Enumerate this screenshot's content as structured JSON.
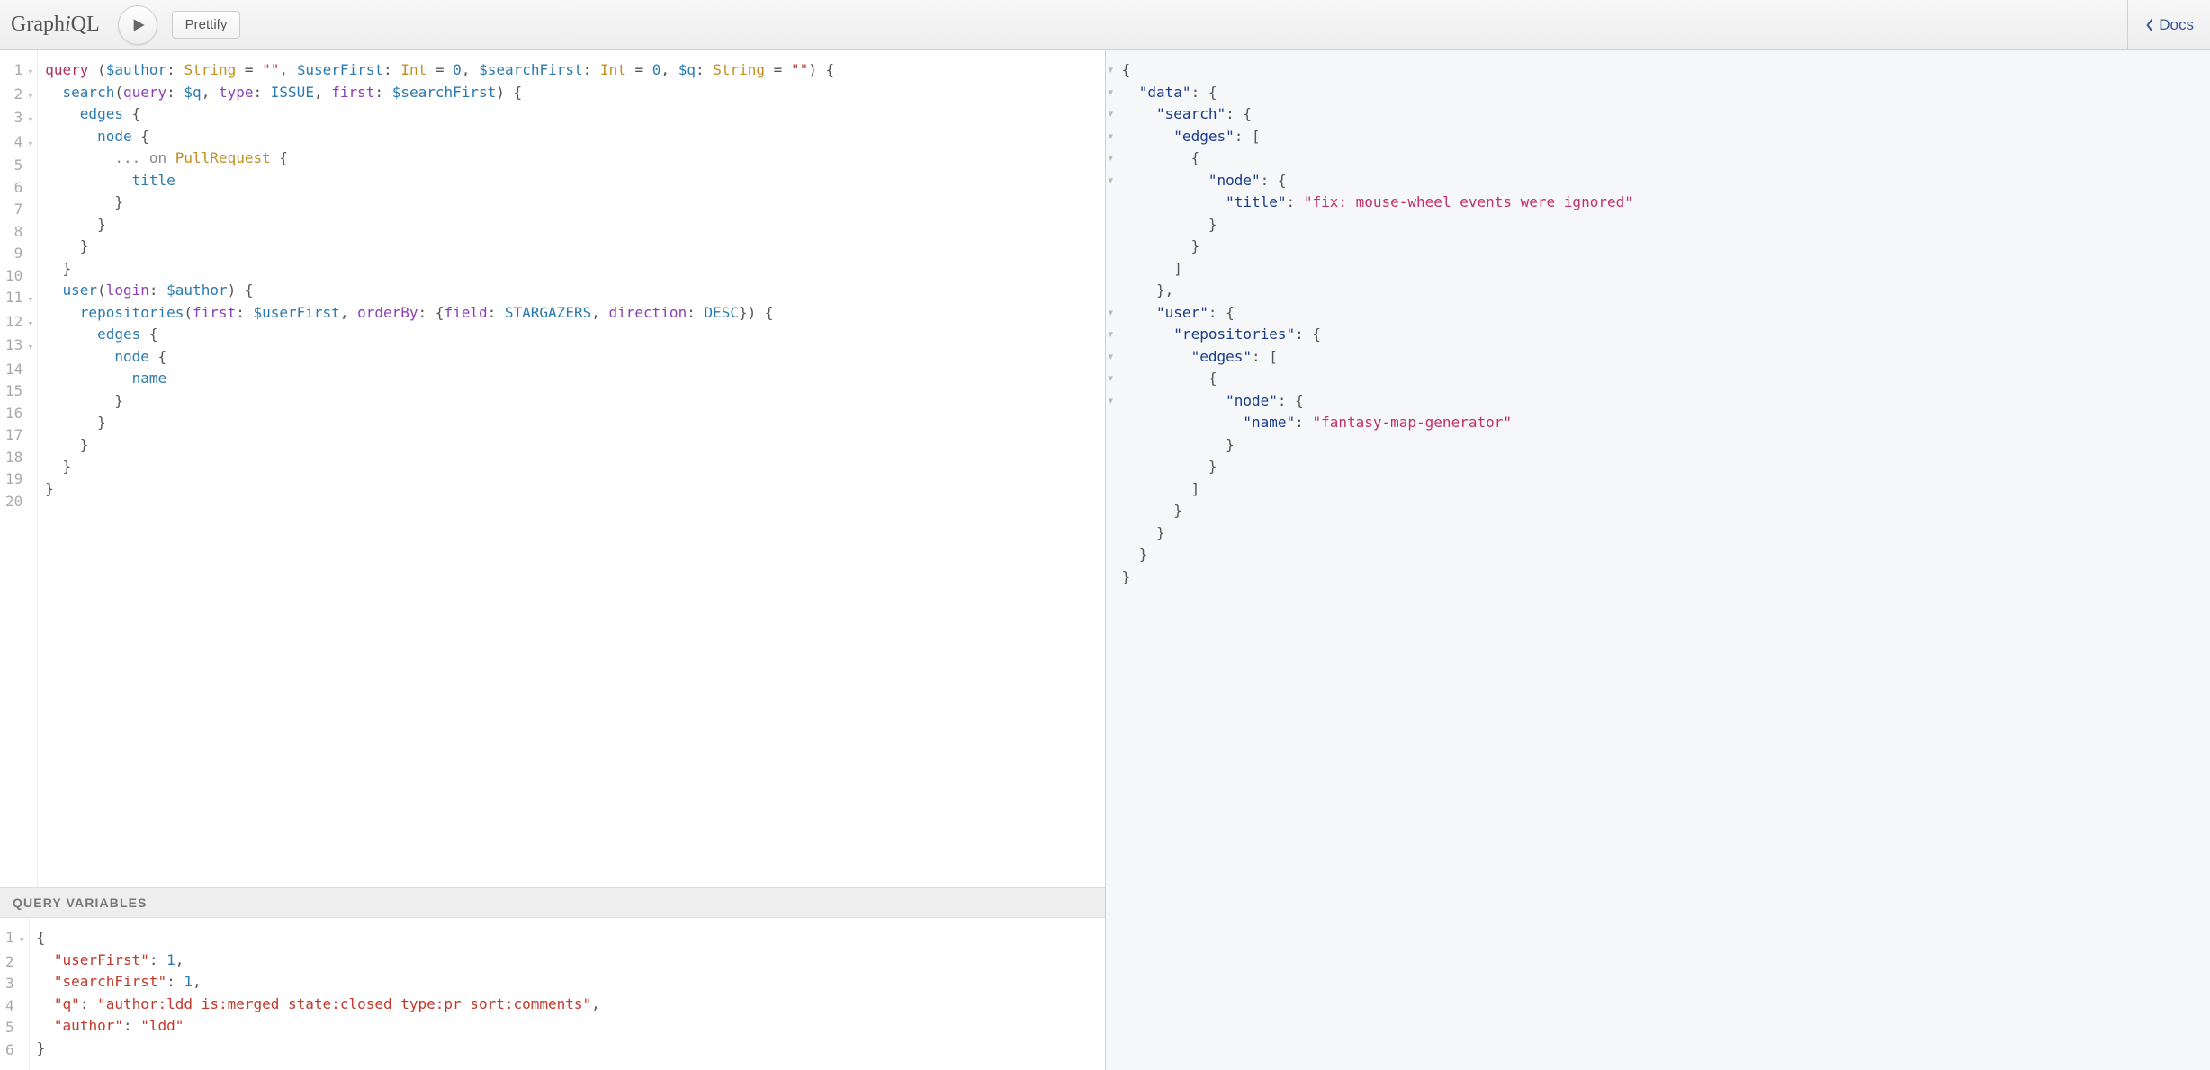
{
  "topbar": {
    "logo_pre": "Graph",
    "logo_i": "i",
    "logo_post": "QL",
    "prettify_label": "Prettify",
    "docs_label": "Docs"
  },
  "query_lines": [
    {
      "n": 1,
      "fold": true,
      "html": "<span class='kw'>query</span> <span class='pn'>(</span><span class='var'>$author</span><span class='pn'>:</span> <span class='type'>String</span> <span class='pn'>=</span> <span class='str'>\"\"</span><span class='pn'>,</span> <span class='var'>$userFirst</span><span class='pn'>:</span> <span class='type'>Int</span> <span class='pn'>=</span> <span class='num'>0</span><span class='pn'>,</span> <span class='var'>$searchFirst</span><span class='pn'>:</span> <span class='type'>Int</span> <span class='pn'>=</span> <span class='num'>0</span><span class='pn'>,</span> <span class='var'>$q</span><span class='pn'>:</span> <span class='type'>String</span> <span class='pn'>=</span> <span class='str'>\"\"</span><span class='pn'>) {</span>"
    },
    {
      "n": 2,
      "fold": true,
      "html": "  <span class='field'>search</span><span class='pn'>(</span><span class='arg'>query</span><span class='pn'>:</span> <span class='var'>$q</span><span class='pn'>,</span> <span class='arg'>type</span><span class='pn'>:</span> <span class='enum'>ISSUE</span><span class='pn'>,</span> <span class='arg'>first</span><span class='pn'>:</span> <span class='var'>$searchFirst</span><span class='pn'>) {</span>"
    },
    {
      "n": 3,
      "fold": true,
      "html": "    <span class='field'>edges</span> <span class='pn'>{</span>"
    },
    {
      "n": 4,
      "fold": true,
      "html": "      <span class='field'>node</span> <span class='pn'>{</span>"
    },
    {
      "n": 5,
      "fold": false,
      "html": "        <span class='on'>... on</span> <span class='type'>PullRequest</span> <span class='pn'>{</span>"
    },
    {
      "n": 6,
      "fold": false,
      "html": "          <span class='field'>title</span>"
    },
    {
      "n": 7,
      "fold": false,
      "html": "        <span class='pn'>}</span>"
    },
    {
      "n": 8,
      "fold": false,
      "html": "      <span class='pn'>}</span>"
    },
    {
      "n": 9,
      "fold": false,
      "html": "    <span class='pn'>}</span>"
    },
    {
      "n": 10,
      "fold": false,
      "html": "  <span class='pn'>}</span>"
    },
    {
      "n": 11,
      "fold": true,
      "html": "  <span class='field'>user</span><span class='pn'>(</span><span class='arg'>login</span><span class='pn'>:</span> <span class='var'>$author</span><span class='pn'>) {</span>"
    },
    {
      "n": 12,
      "fold": true,
      "html": "    <span class='field'>repositories</span><span class='pn'>(</span><span class='arg'>first</span><span class='pn'>:</span> <span class='var'>$userFirst</span><span class='pn'>,</span> <span class='arg'>orderBy</span><span class='pn'>: {</span><span class='arg'>field</span><span class='pn'>:</span> <span class='enum'>STARGAZERS</span><span class='pn'>,</span> <span class='arg'>direction</span><span class='pn'>:</span> <span class='enum'>DESC</span><span class='pn'>}) {</span>"
    },
    {
      "n": 13,
      "fold": true,
      "html": "      <span class='field'>edges</span> <span class='pn'>{</span>"
    },
    {
      "n": 14,
      "fold": false,
      "html": "        <span class='field'>node</span> <span class='pn'>{</span>"
    },
    {
      "n": 15,
      "fold": false,
      "html": "          <span class='field'>name</span>"
    },
    {
      "n": 16,
      "fold": false,
      "html": "        <span class='pn'>}</span>"
    },
    {
      "n": 17,
      "fold": false,
      "html": "      <span class='pn'>}</span>"
    },
    {
      "n": 18,
      "fold": false,
      "html": "    <span class='pn'>}</span>"
    },
    {
      "n": 19,
      "fold": false,
      "html": "  <span class='pn'>}</span>"
    },
    {
      "n": 20,
      "fold": false,
      "html": "<span class='pn'>}</span>"
    }
  ],
  "vars_header": "QUERY VARIABLES",
  "vars_lines": [
    {
      "n": 1,
      "fold": true,
      "html": "<span class='pn'>{</span>"
    },
    {
      "n": 2,
      "fold": false,
      "html": "  <span class='str'>\"userFirst\"</span><span class='pn'>:</span> <span class='num'>1</span><span class='pn'>,</span>"
    },
    {
      "n": 3,
      "fold": false,
      "html": "  <span class='str'>\"searchFirst\"</span><span class='pn'>:</span> <span class='num'>1</span><span class='pn'>,</span>"
    },
    {
      "n": 4,
      "fold": false,
      "html": "  <span class='str'>\"q\"</span><span class='pn'>:</span> <span class='str'>\"author:ldd is:merged state:closed type:pr sort:comments\"</span><span class='pn'>,</span>"
    },
    {
      "n": 5,
      "fold": false,
      "html": "  <span class='str'>\"author\"</span><span class='pn'>:</span> <span class='str'>\"ldd\"</span>"
    },
    {
      "n": 6,
      "fold": false,
      "html": "<span class='pn'>}</span>"
    }
  ],
  "response_lines": [
    {
      "fold": true,
      "html": "<span class='rp'>{</span>"
    },
    {
      "fold": true,
      "html": "  <span class='rkey'>\"data\"</span><span class='rp'>: {</span>"
    },
    {
      "fold": true,
      "html": "    <span class='rkey'>\"search\"</span><span class='rp'>: {</span>"
    },
    {
      "fold": true,
      "html": "      <span class='rkey'>\"edges\"</span><span class='rp'>: [</span>"
    },
    {
      "fold": true,
      "html": "        <span class='rp'>{</span>"
    },
    {
      "fold": true,
      "html": "          <span class='rkey'>\"node\"</span><span class='rp'>: {</span>"
    },
    {
      "fold": false,
      "html": "            <span class='rkey'>\"title\"</span><span class='rp'>:</span> <span class='rstr'>\"fix: mouse-wheel events were ignored\"</span>"
    },
    {
      "fold": false,
      "html": "          <span class='rp'>}</span>"
    },
    {
      "fold": false,
      "html": "        <span class='rp'>}</span>"
    },
    {
      "fold": false,
      "html": "      <span class='rp'>]</span>"
    },
    {
      "fold": false,
      "html": "    <span class='rp'>},</span>"
    },
    {
      "fold": true,
      "html": "    <span class='rkey'>\"user\"</span><span class='rp'>: {</span>"
    },
    {
      "fold": true,
      "html": "      <span class='rkey'>\"repositories\"</span><span class='rp'>: {</span>"
    },
    {
      "fold": true,
      "html": "        <span class='rkey'>\"edges\"</span><span class='rp'>: [</span>"
    },
    {
      "fold": true,
      "html": "          <span class='rp'>{</span>"
    },
    {
      "fold": true,
      "html": "            <span class='rkey'>\"node\"</span><span class='rp'>: {</span>"
    },
    {
      "fold": false,
      "html": "              <span class='rkey'>\"name\"</span><span class='rp'>:</span> <span class='rstr'>\"fantasy-map-generator\"</span>"
    },
    {
      "fold": false,
      "html": "            <span class='rp'>}</span>"
    },
    {
      "fold": false,
      "html": "          <span class='rp'>}</span>"
    },
    {
      "fold": false,
      "html": "        <span class='rp'>]</span>"
    },
    {
      "fold": false,
      "html": "      <span class='rp'>}</span>"
    },
    {
      "fold": false,
      "html": "    <span class='rp'>}</span>"
    },
    {
      "fold": false,
      "html": "  <span class='rp'>}</span>"
    },
    {
      "fold": false,
      "html": "<span class='rp'>}</span>"
    }
  ]
}
